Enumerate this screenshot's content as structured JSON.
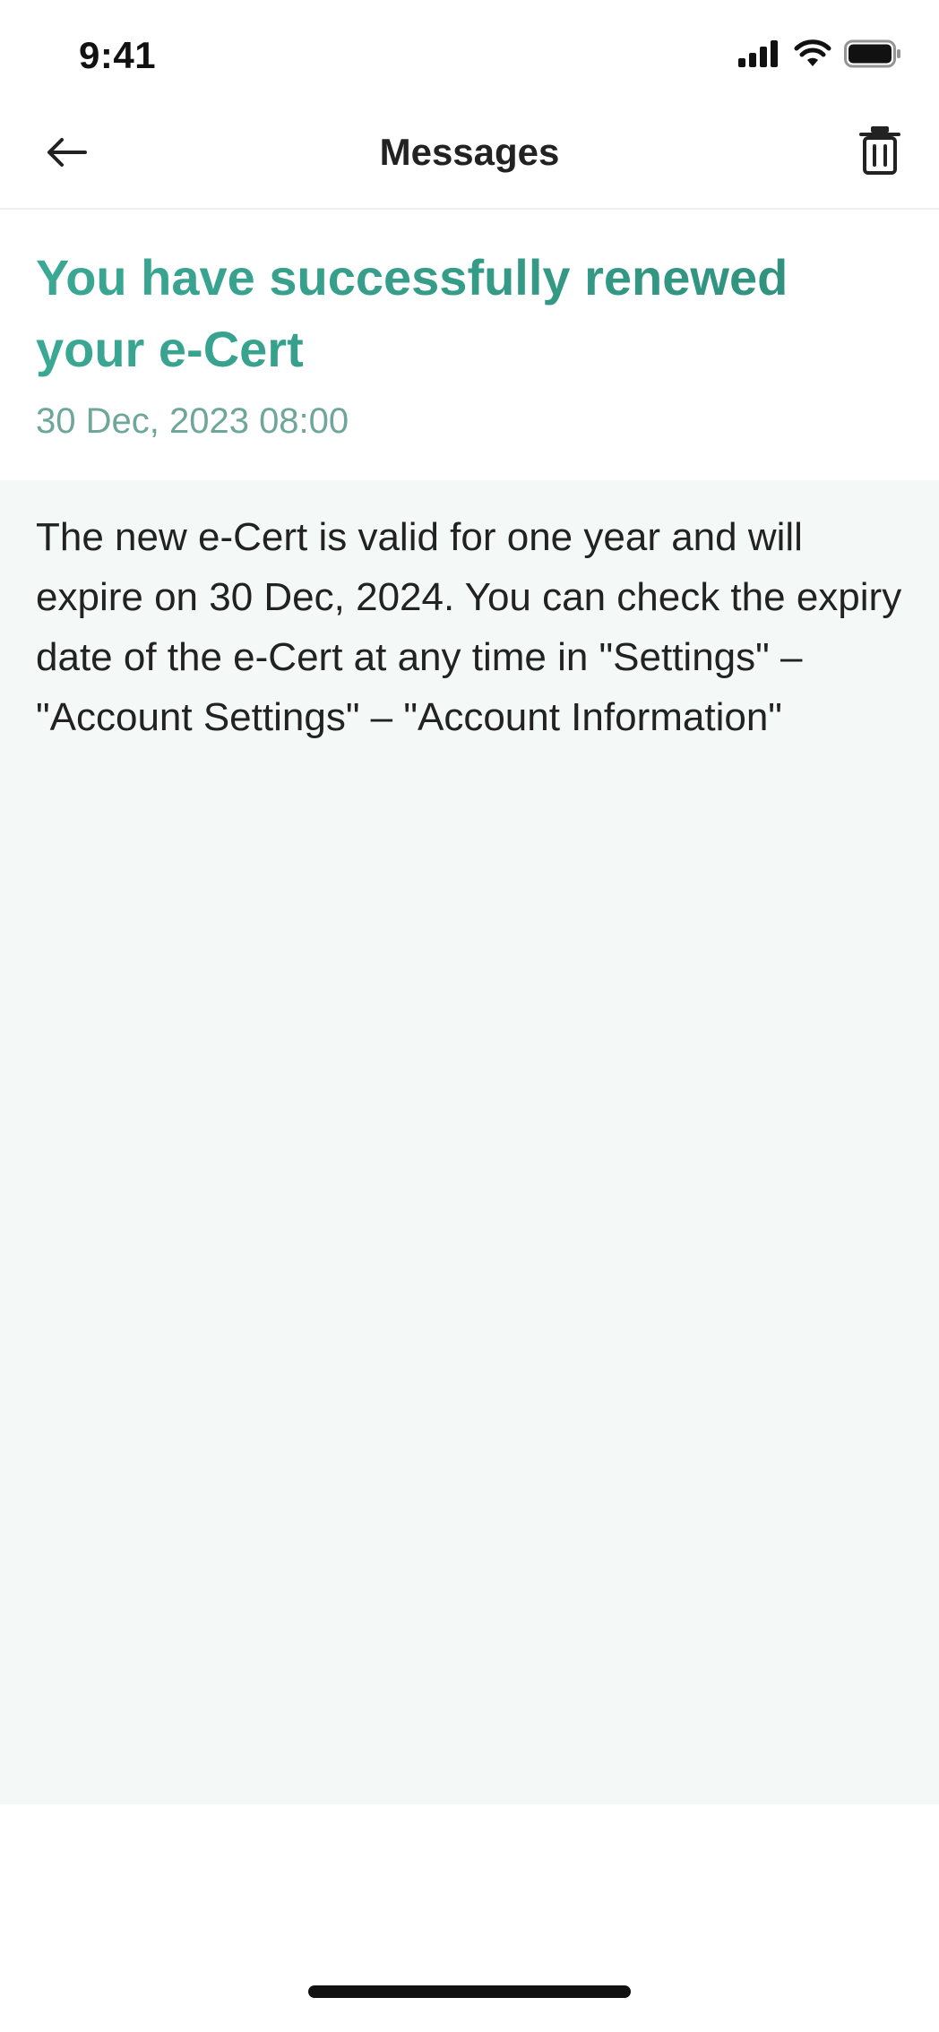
{
  "status_bar": {
    "time": "9:41",
    "icons": [
      "signal-icon",
      "wifi-icon",
      "battery-icon"
    ]
  },
  "nav": {
    "title": "Messages",
    "back_icon": "arrow-left-icon",
    "delete_icon": "trash-icon"
  },
  "message": {
    "title": "You have successfully renewed your e-Cert",
    "date": "30 Dec, 2023 08:00",
    "body": "The new e-Cert is valid for one year and will expire on 30 Dec, 2024. You can check the expiry date of the e-Cert at any time in \"Settings\" – \"Account Settings\" – \"Account Information\""
  },
  "colors": {
    "title_accent": "#2e9a86",
    "date_text": "#6ea79a",
    "body_background": "#f4f8f7"
  }
}
